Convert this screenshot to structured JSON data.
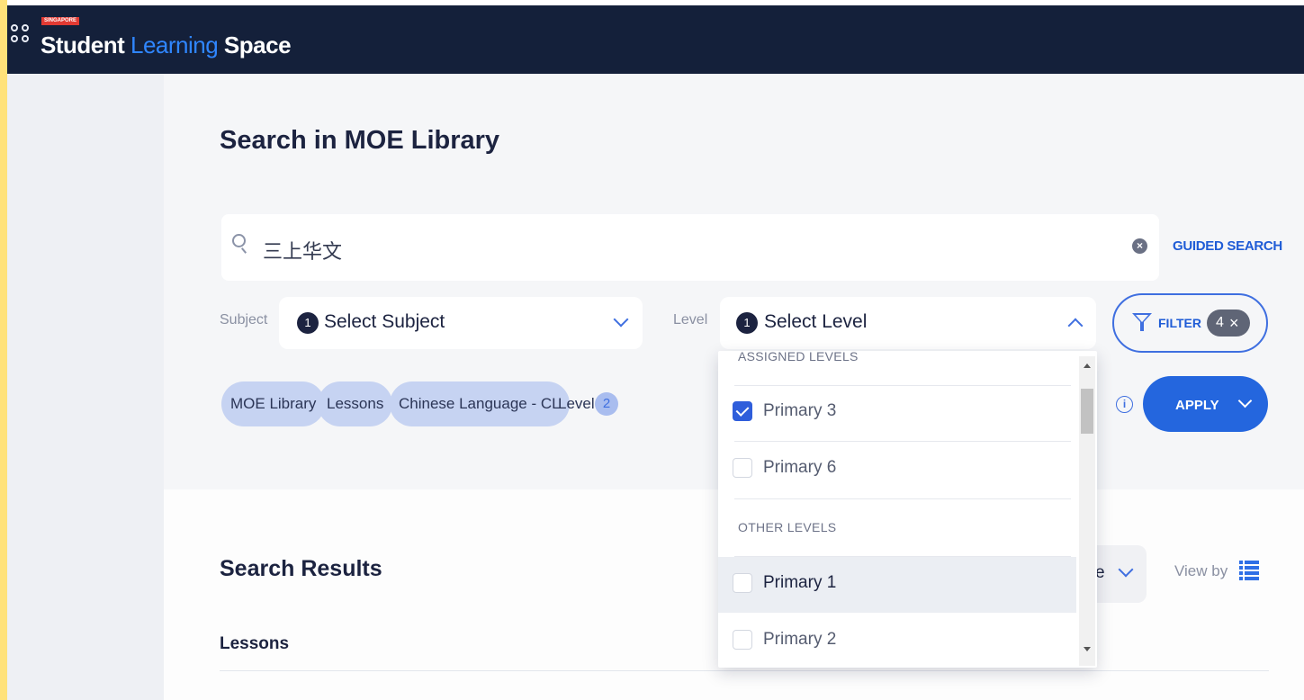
{
  "header": {
    "badge": "SINGAPORE",
    "logo_part1": "Student ",
    "logo_part2": "Learning",
    "logo_part3": " Space"
  },
  "page_title": "Search in MOE Library",
  "search": {
    "value": "三上华文",
    "guided_search_label": "GUIDED SEARCH"
  },
  "subject": {
    "label": "Subject",
    "count": "1",
    "placeholder": "Select Subject"
  },
  "level": {
    "label": "Level",
    "count": "1",
    "placeholder": "Select Level"
  },
  "filter": {
    "label": "FILTER",
    "count": "4"
  },
  "chips": {
    "library": "MOE Library",
    "lessons": "Lessons",
    "subject": "Chinese Language - CL",
    "level_label": "Level",
    "level_count": "2"
  },
  "apply_label": "APPLY",
  "dropdown": {
    "assigned_header": "ASSIGNED LEVELS",
    "other_header": "OTHER LEVELS",
    "assigned_items": [
      {
        "label": "Primary 3",
        "checked": true
      },
      {
        "label": "Primary 6",
        "checked": false
      }
    ],
    "other_items": [
      {
        "label": "Primary 1",
        "checked": false
      },
      {
        "label": "Primary 2",
        "checked": false
      }
    ]
  },
  "results": {
    "title": "Search Results",
    "subheading": "Lessons",
    "sort_partial": "e",
    "view_by_label": "View by"
  },
  "colors": {
    "topbar": "#14203a",
    "accent": "#2466de",
    "chip": "#c6d3f2"
  }
}
